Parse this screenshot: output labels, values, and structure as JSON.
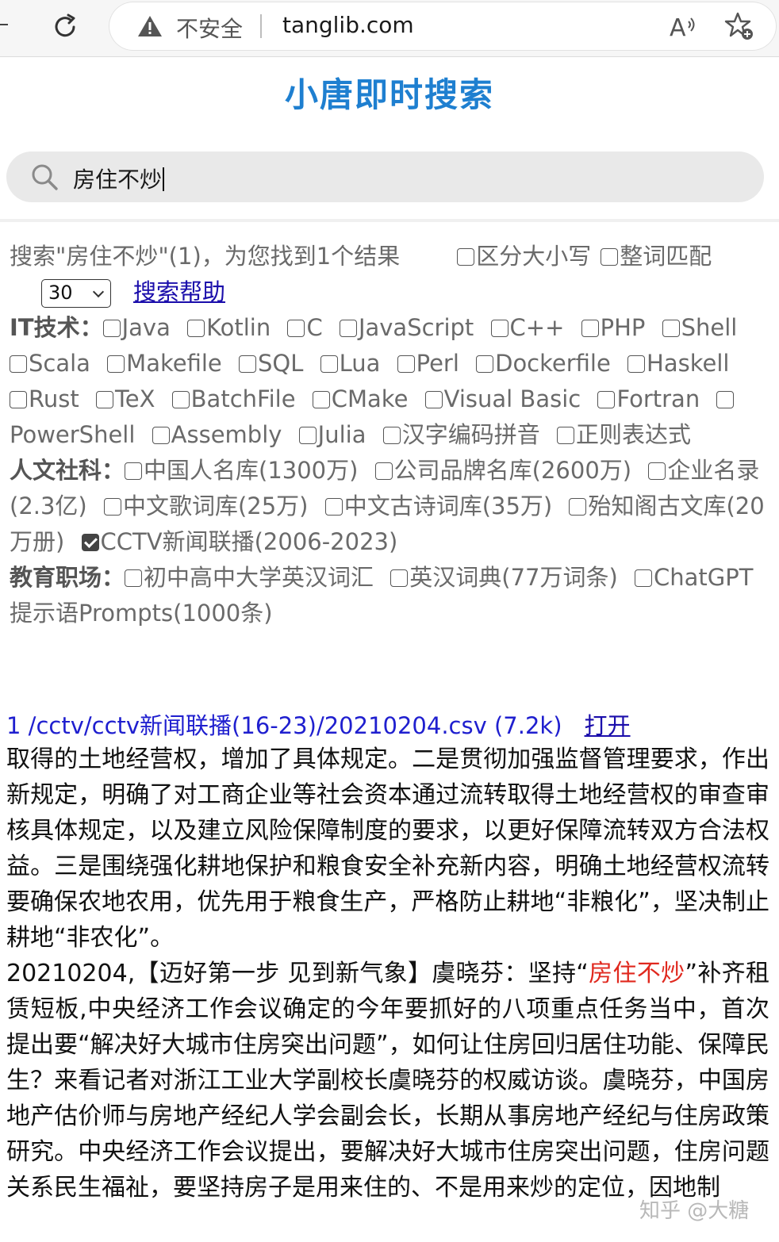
{
  "browser": {
    "security_label": "不安全",
    "url": "tanglib.com"
  },
  "page": {
    "title": "小唐即时搜索",
    "search_value": "房住不炒"
  },
  "filters": {
    "summary": "搜索\"房住不炒\"(1)，为您找到1个结果",
    "case_sensitive_label": "区分大小写",
    "whole_word_label": "整词匹配",
    "page_size_value": "30",
    "help_link": "搜索帮助",
    "groups": [
      {
        "name": "IT技术：",
        "options": [
          {
            "label": "Java",
            "checked": false
          },
          {
            "label": "Kotlin",
            "checked": false
          },
          {
            "label": "C",
            "checked": false
          },
          {
            "label": "JavaScript",
            "checked": false
          },
          {
            "label": "C++",
            "checked": false
          },
          {
            "label": "PHP",
            "checked": false
          },
          {
            "label": "Shell",
            "checked": false
          },
          {
            "label": "Scala",
            "checked": false
          },
          {
            "label": "Makefile",
            "checked": false
          },
          {
            "label": "SQL",
            "checked": false
          },
          {
            "label": "Lua",
            "checked": false
          },
          {
            "label": "Perl",
            "checked": false
          },
          {
            "label": "Dockerfile",
            "checked": false
          },
          {
            "label": "Haskell",
            "checked": false
          },
          {
            "label": "Rust",
            "checked": false
          },
          {
            "label": "TeX",
            "checked": false
          },
          {
            "label": "BatchFile",
            "checked": false
          },
          {
            "label": "CMake",
            "checked": false
          },
          {
            "label": "Visual Basic",
            "checked": false
          },
          {
            "label": "Fortran",
            "checked": false
          },
          {
            "label": "PowerShell",
            "checked": false
          },
          {
            "label": "Assembly",
            "checked": false
          },
          {
            "label": "Julia",
            "checked": false
          },
          {
            "label": "汉字编码拼音",
            "checked": false
          },
          {
            "label": "正则表达式",
            "checked": false
          }
        ]
      },
      {
        "name": "人文社科：",
        "options": [
          {
            "label": "中国人名库(1300万)",
            "checked": false
          },
          {
            "label": "公司品牌名库(2600万)",
            "checked": false
          },
          {
            "label": "企业名录(2.3亿)",
            "checked": false
          },
          {
            "label": "中文歌词库(25万)",
            "checked": false
          },
          {
            "label": "中文古诗词库(35万)",
            "checked": false
          },
          {
            "label": "殆知阁古文库(20万册)",
            "checked": false
          },
          {
            "label": "CCTV新闻联播(2006-2023)",
            "checked": true
          }
        ]
      },
      {
        "name": "教育职场：",
        "options": [
          {
            "label": "初中高中大学英汉词汇",
            "checked": false
          },
          {
            "label": "英汉词典(77万词条)",
            "checked": false
          },
          {
            "label": "ChatGPT提示语Prompts(1000条)",
            "checked": false
          }
        ]
      }
    ]
  },
  "result": {
    "header": "1 /cctv/cctv新闻联播(16-23)/20210204.csv (7.2k)",
    "open_label": "打开",
    "text_before": "取得的土地经营权，增加了具体规定。二是贯彻加强监督管理要求，作出新规定，明确了对工商企业等社会资本通过流转取得土地经营权的审查审核具体规定，以及建立风险保障制度的要求，以更好保障流转双方合法权益。三是围绕强化耕地保护和粮食安全补充新内容，明确土地经营权流转要确保农地农用，优先用于粮食生产，严格防止耕地“非粮化”，坚决制止耕地“非农化”。",
    "text_line2_before": "20210204,【迈好第一步 见到新气象】虞晓芬：坚持“",
    "highlight": "房住不炒",
    "text_after": "”补齐租赁短板,中央经济工作会议确定的今年要抓好的八项重点任务当中，首次提出要“解决好大城市住房突出问题”，如何让住房回归居住功能、保障民生？来看记者对浙江工业大学副校长虞晓芬的权威访谈。虞晓芬，中国房地产估价师与房地产经纪人学会副会长，长期从事房地产经纪与住房政策研究。中央经济工作会议提出，要解决好大城市住房突出问题，住房问题关系民生福祉，要坚持房子是用来住的、不是用来炒的定位，因地制"
  },
  "watermark": "知乎 @大糖"
}
